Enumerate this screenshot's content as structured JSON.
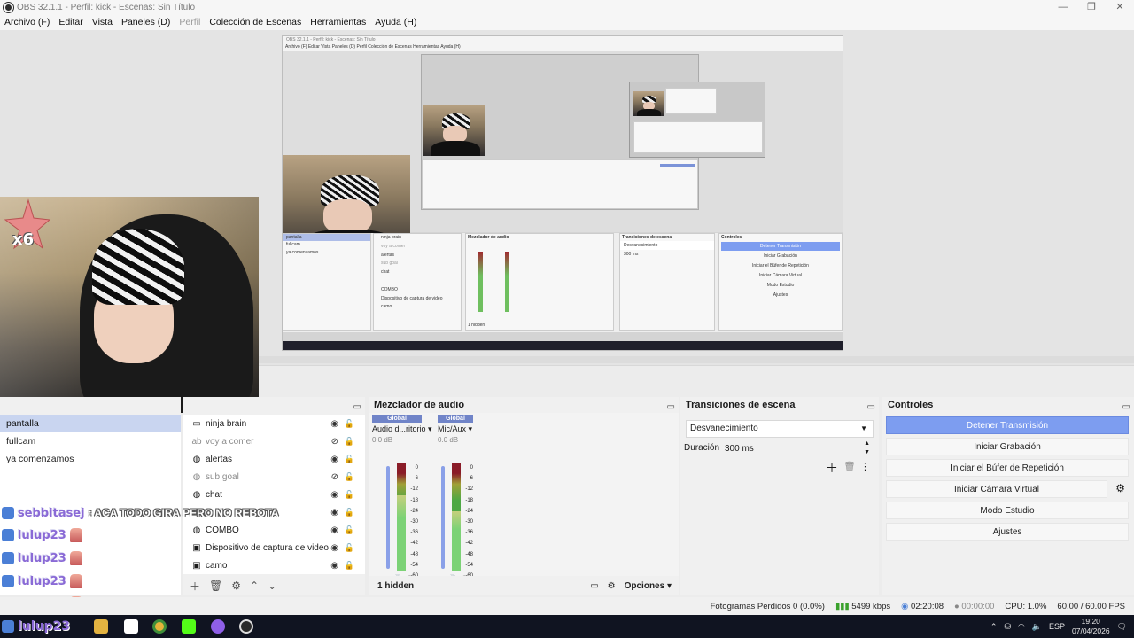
{
  "window": {
    "title": "OBS 32.1.1 - Perfil: kick - Escenas: Sin Título",
    "controls": [
      "—",
      "❐",
      "✕"
    ]
  },
  "menu": {
    "items": [
      {
        "label": "Archivo (F)",
        "disabled": false
      },
      {
        "label": "Editar",
        "disabled": false
      },
      {
        "label": "Vista",
        "disabled": false
      },
      {
        "label": "Paneles (D)",
        "disabled": false
      },
      {
        "label": "Perfil",
        "disabled": true
      },
      {
        "label": "Colección de Escenas",
        "disabled": false
      },
      {
        "label": "Herramientas",
        "disabled": false
      },
      {
        "label": "Ayuda (H)",
        "disabled": false
      }
    ]
  },
  "overlay": {
    "multiplier": "x6",
    "chat": [
      {
        "user": "sebbitasej",
        "message": ": ACA TODO GIRA PERO NO REBOTA"
      },
      {
        "user": "lulup23",
        "message": ""
      },
      {
        "user": "lulup23",
        "message": ""
      },
      {
        "user": "lulup23",
        "message": ""
      },
      {
        "user": "lulup23",
        "message": ""
      }
    ],
    "taskbar_user": "lulup23"
  },
  "scenes": {
    "items": [
      "pantalla",
      "fullcam",
      "ya comenzamos"
    ],
    "selected": 0
  },
  "sources": {
    "items": [
      {
        "label": "ninja brain",
        "icon": "window-icon",
        "visible": true
      },
      {
        "label": "voy a comer",
        "icon": "text-icon",
        "visible": false
      },
      {
        "label": "alertas",
        "icon": "browser-icon",
        "visible": true
      },
      {
        "label": "sub goal",
        "icon": "browser-icon",
        "visible": false
      },
      {
        "label": "chat",
        "icon": "browser-icon",
        "visible": true
      },
      {
        "label": "",
        "icon": "browser-icon",
        "visible": true
      },
      {
        "label": "COMBO",
        "icon": "browser-icon",
        "visible": true
      },
      {
        "label": "Dispositivo de captura de video",
        "icon": "camera-icon",
        "visible": true
      },
      {
        "label": "camo",
        "icon": "camera-icon",
        "visible": true
      }
    ]
  },
  "mixer": {
    "title": "Mezclador de audio",
    "channels": [
      {
        "badge": "Global",
        "name": "Audio d...ritorio",
        "db": "0.0 dB",
        "level": 0.7
      },
      {
        "badge": "Global",
        "name": "Mic/Aux",
        "db": "0.0 dB",
        "level": 0.55
      }
    ],
    "scale": [
      "0",
      "-6",
      "-12",
      "-18",
      "-24",
      "-30",
      "-36",
      "-42",
      "-48",
      "-54",
      "-60"
    ],
    "hidden": "1 hidden",
    "options": "Opciones"
  },
  "transitions": {
    "title": "Transiciones de escena",
    "selected": "Desvanecimiento",
    "duration_label": "Duración",
    "duration_value": "300 ms"
  },
  "controls": {
    "title": "Controles",
    "buttons": [
      {
        "label": "Detener Transmisión",
        "active": true
      },
      {
        "label": "Iniciar Grabación",
        "active": false
      },
      {
        "label": "Iniciar el Búfer de Repetición",
        "active": false
      },
      {
        "label": "Iniciar Cámara Virtual",
        "active": false
      },
      {
        "label": "Modo Estudio",
        "active": false
      },
      {
        "label": "Ajustes",
        "active": false
      }
    ]
  },
  "status": {
    "dropped": "Fotogramas Perdidos 0 (0.0%)",
    "bitrate": "5499 kbps",
    "stream_time": "02:20:08",
    "rec_time": "00:00:00",
    "cpu": "CPU: 1.0%",
    "fps": "60.00 / 60.00 FPS"
  },
  "taskbar": {
    "lang": "ESP",
    "time": "19:20",
    "date": "07/04/2026"
  },
  "nested": {
    "title": "OBS 32.1.1 - Perfil: kick - Escenas: Sin Título",
    "menu": "Archivo (F)   Editar   Vista   Paneles (D)   Perfil   Colección de Escenas   Herramientas   Ayuda (H)",
    "scenes": [
      "pantalla",
      "fullcam",
      "ya comenzamos"
    ],
    "mixer_title": "Mezclador de audio",
    "transitions_title": "Transiciones de escena",
    "controls_title": "Controles",
    "controls": [
      "Detener Transmisión",
      "Iniciar Grabación",
      "Iniciar el Búfer de Repetición",
      "Iniciar Cámara Virtual",
      "Modo Estudio",
      "Ajustes"
    ],
    "transition_value": "Desvanecimiento",
    "duration": "300 ms",
    "hidden": "1 hidden",
    "sources": [
      "ninja brain",
      "voy a comer",
      "alertas",
      "sub goal",
      "chat",
      "",
      "COMBO",
      "Dispositivo de captura de video",
      "camo"
    ]
  }
}
